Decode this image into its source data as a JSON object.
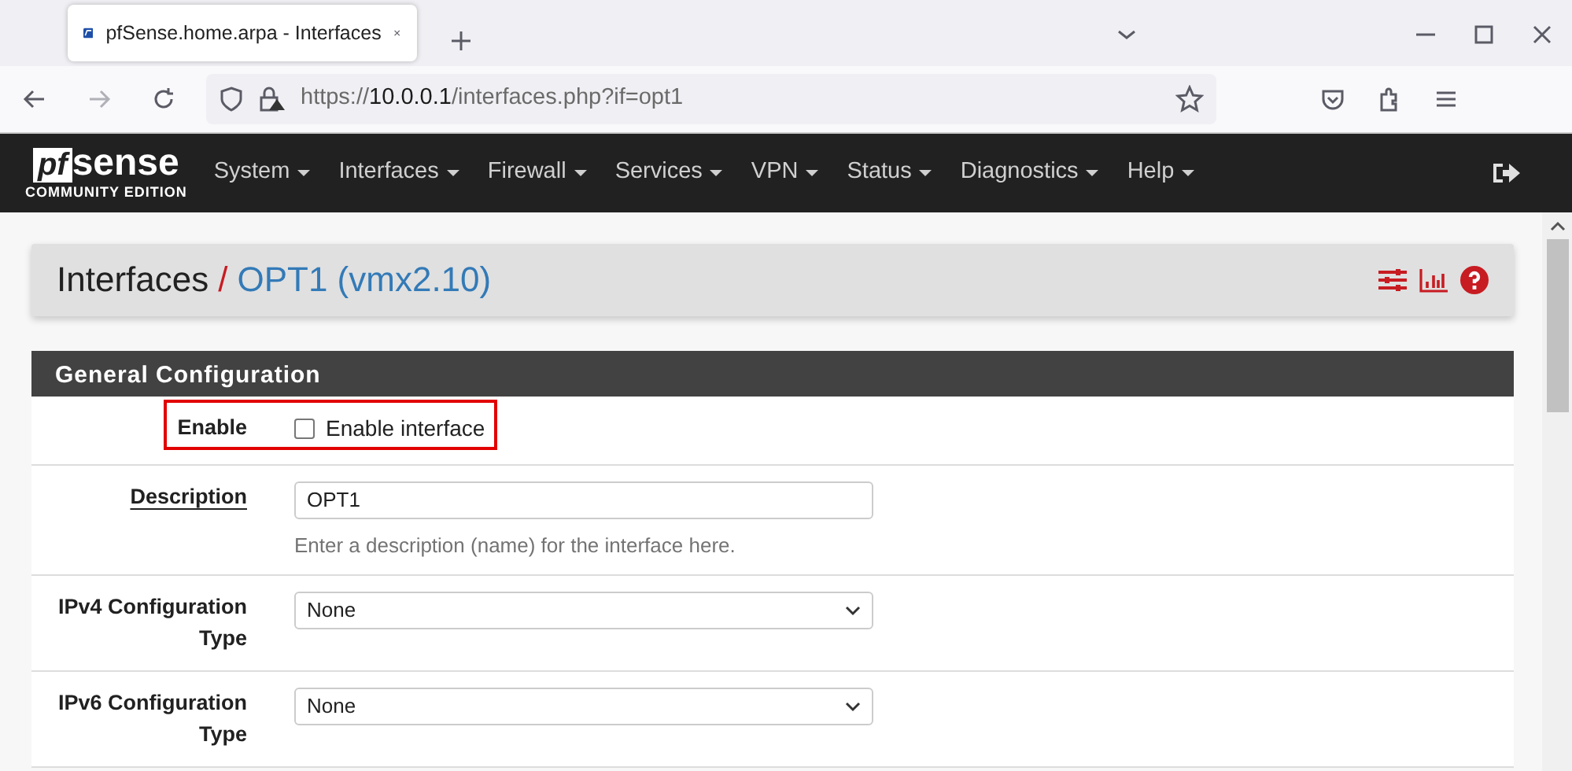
{
  "browser": {
    "tab": {
      "title": "pfSense.home.arpa - Interfaces",
      "selected": true
    },
    "url": {
      "scheme": "https://",
      "host": "10.0.0.1",
      "path": "/interfaces.php?if=opt1"
    }
  },
  "logo": {
    "mark": "pf",
    "word": "sense",
    "edition": "COMMUNITY EDITION"
  },
  "menu": [
    {
      "label": "System"
    },
    {
      "label": "Interfaces"
    },
    {
      "label": "Firewall"
    },
    {
      "label": "Services"
    },
    {
      "label": "VPN"
    },
    {
      "label": "Status"
    },
    {
      "label": "Diagnostics"
    },
    {
      "label": "Help"
    }
  ],
  "breadcrumb": [
    {
      "label": "Interfaces",
      "kind": "text"
    },
    {
      "label": "/",
      "kind": "separator"
    },
    {
      "label": "OPT1 (vmx2.10)",
      "kind": "link"
    }
  ],
  "panel": {
    "title": "General Configuration",
    "fields": [
      {
        "kind": "checkbox",
        "label": "Enable",
        "option": "Enable interface",
        "checked": false,
        "highlighted": true
      },
      {
        "kind": "text",
        "label": "Description",
        "value": "OPT1",
        "help": "Enter a description (name) for the interface here.",
        "highlighted": false
      },
      {
        "kind": "select",
        "label": "IPv4 Configuration Type",
        "value": "None",
        "highlighted": false
      },
      {
        "kind": "select",
        "label": "IPv6 Configuration Type",
        "value": "None",
        "highlighted": false
      }
    ]
  }
}
